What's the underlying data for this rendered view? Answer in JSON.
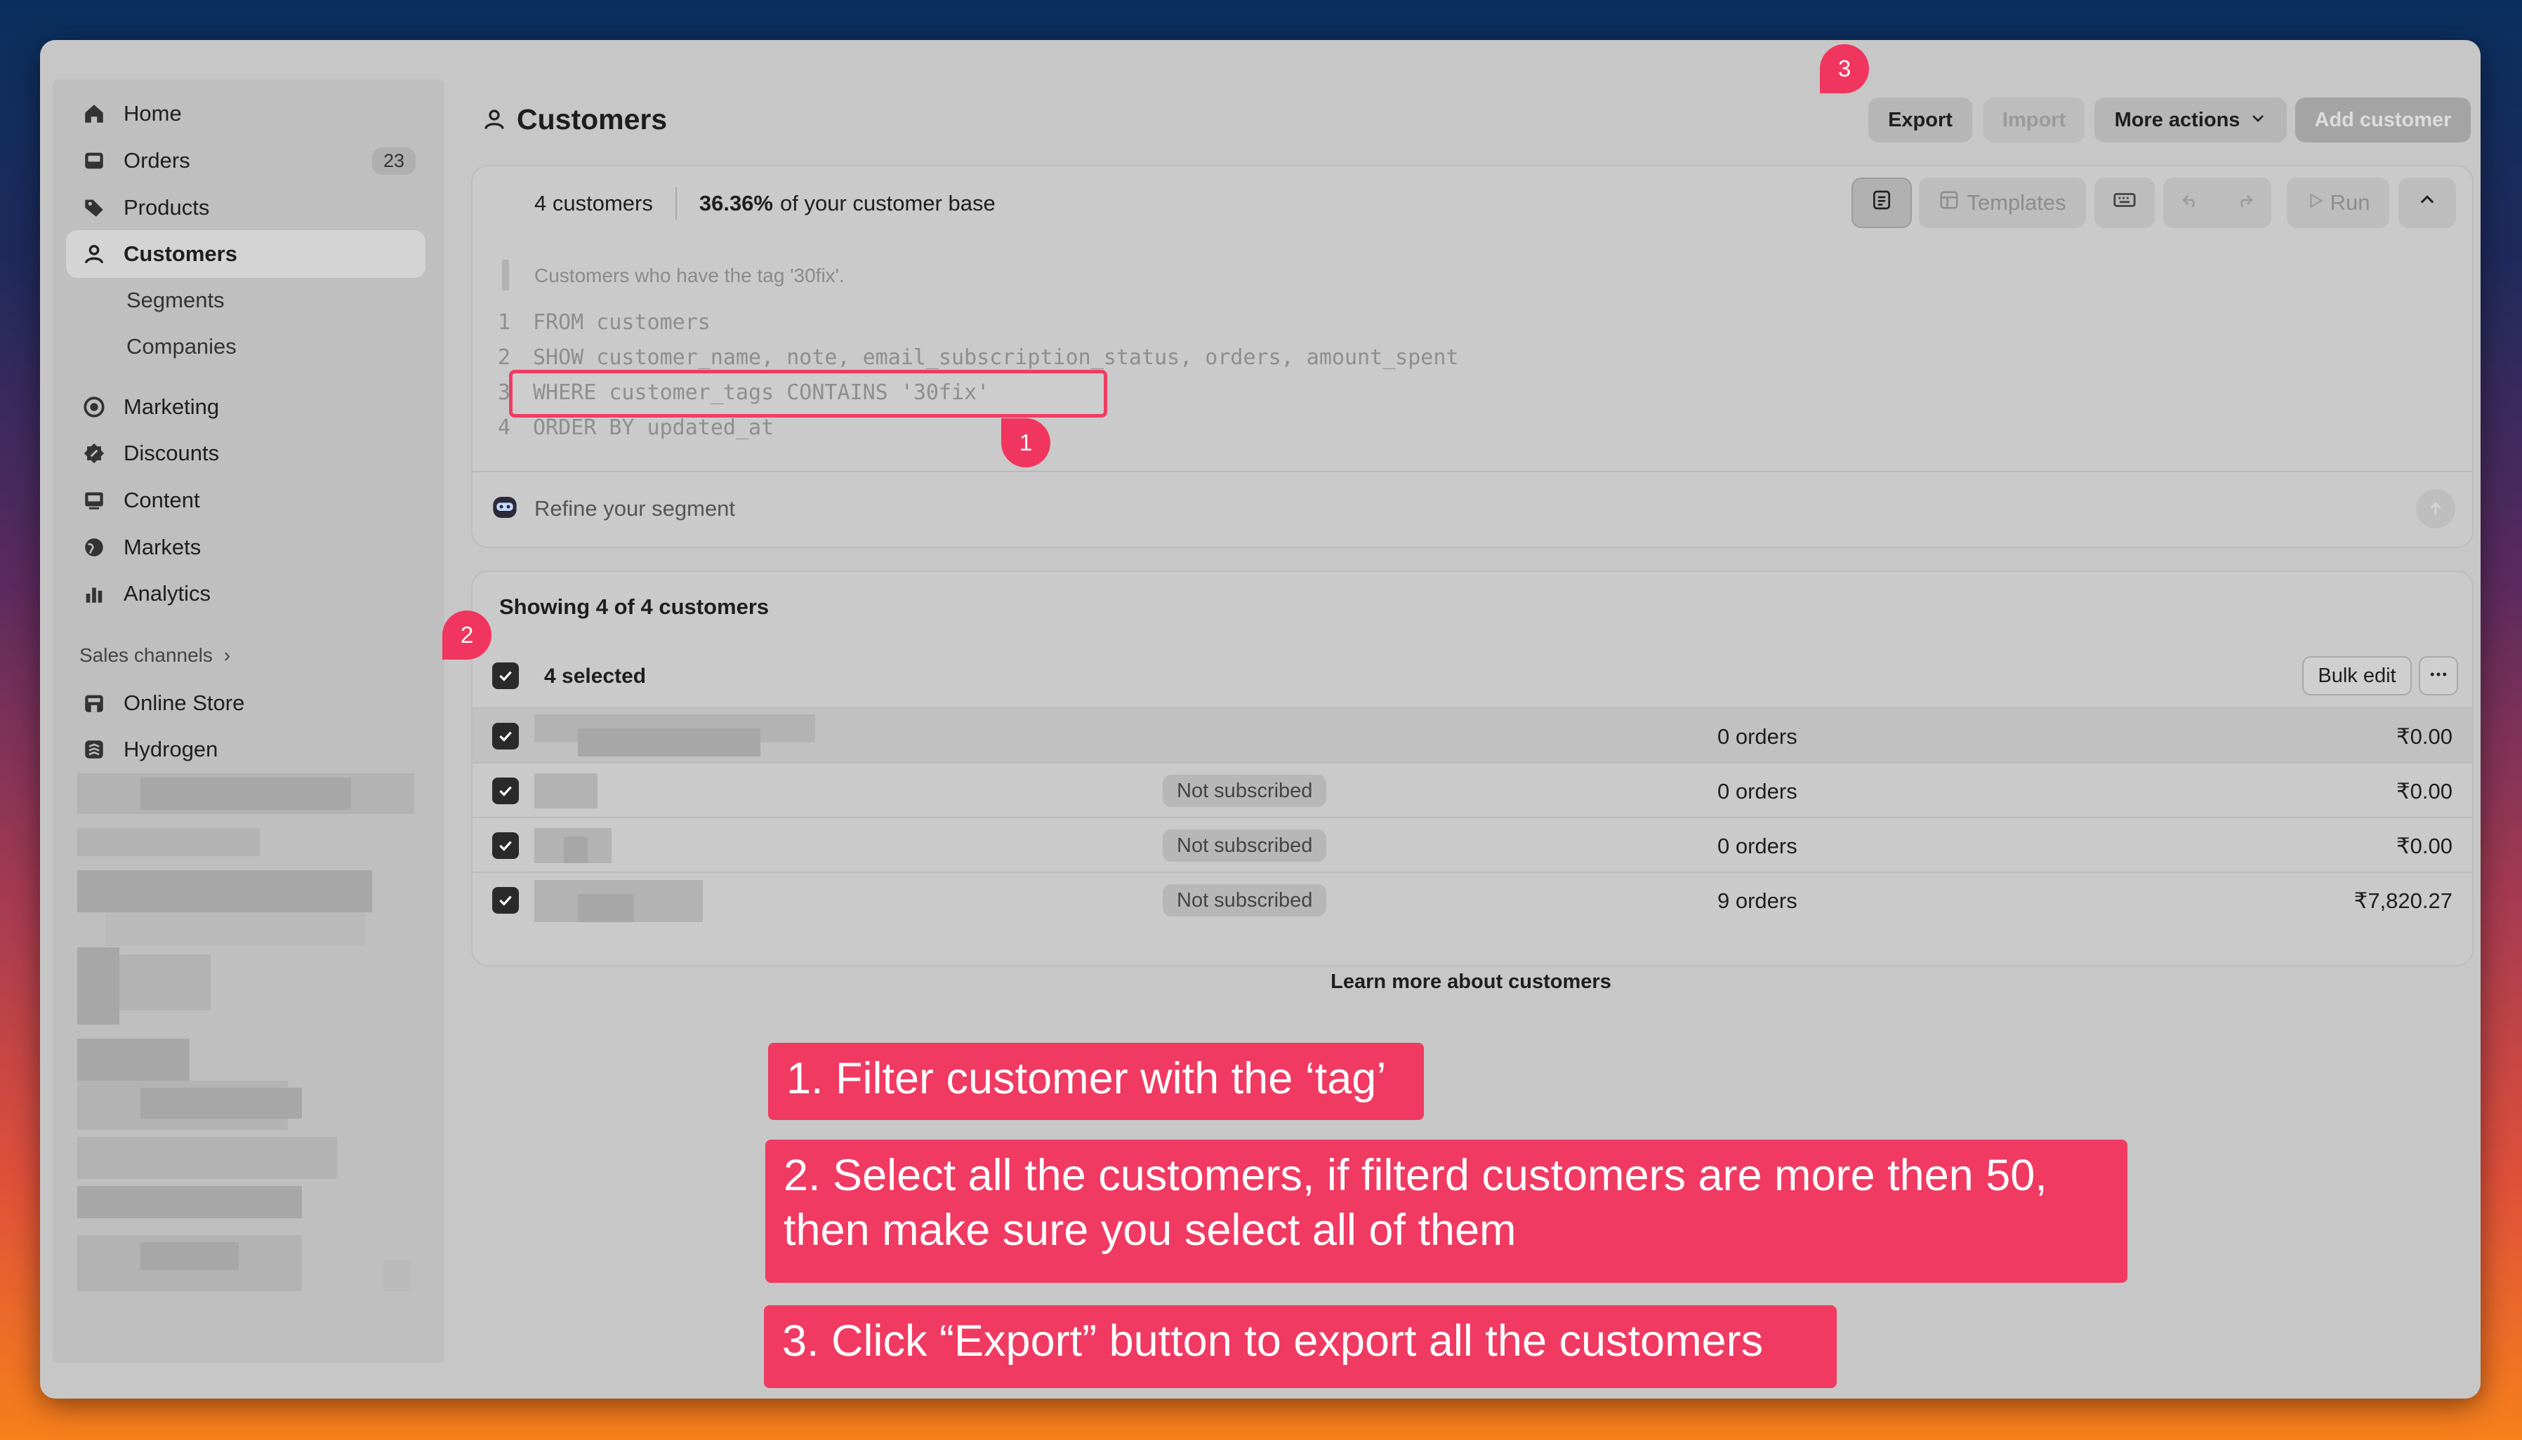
{
  "sidebar": {
    "items": [
      {
        "label": "Home",
        "icon": "home-icon"
      },
      {
        "label": "Orders",
        "icon": "inbox-icon",
        "count": "23"
      },
      {
        "label": "Products",
        "icon": "tag-icon"
      },
      {
        "label": "Customers",
        "icon": "person-icon",
        "active": true
      },
      {
        "label": "Segments"
      },
      {
        "label": "Companies"
      },
      {
        "label": "Marketing",
        "icon": "target-icon"
      },
      {
        "label": "Discounts",
        "icon": "discount-icon"
      },
      {
        "label": "Content",
        "icon": "image-icon"
      },
      {
        "label": "Markets",
        "icon": "globe-icon"
      },
      {
        "label": "Analytics",
        "icon": "bar-chart-icon"
      }
    ],
    "sales_channels_label": "Sales channels",
    "channels": [
      {
        "label": "Online Store",
        "icon": "store-icon"
      },
      {
        "label": "Hydrogen",
        "icon": "hydrogen-icon"
      }
    ]
  },
  "header": {
    "title": "Customers",
    "export_label": "Export",
    "import_label": "Import",
    "more_actions_label": "More actions",
    "add_customer_label": "Add customer"
  },
  "query": {
    "customer_count": "4 customers",
    "base_percent": "36.36%",
    "base_suffix": "of your customer base",
    "templates_label": "Templates",
    "run_label": "Run",
    "description": "Customers who have the tag '30fix'.",
    "lines": [
      {
        "num": "1",
        "code": "FROM customers"
      },
      {
        "num": "2",
        "code": "SHOW customer_name, note, email_subscription_status, orders, amount_spent"
      },
      {
        "num": "3",
        "code": "WHERE customer_tags CONTAINS '30fix'"
      },
      {
        "num": "4",
        "code": "ORDER BY updated_at"
      }
    ],
    "refine_placeholder": "Refine your segment"
  },
  "table": {
    "showing": "Showing 4 of 4 customers",
    "selected": "4 selected",
    "bulk_edit_label": "Bulk edit",
    "rows": [
      {
        "subscription": "",
        "orders": "0 orders",
        "amount": "₹0.00"
      },
      {
        "subscription": "Not subscribed",
        "orders": "0 orders",
        "amount": "₹0.00"
      },
      {
        "subscription": "Not subscribed",
        "orders": "0 orders",
        "amount": "₹0.00"
      },
      {
        "subscription": "Not subscribed",
        "orders": "9 orders",
        "amount": "₹7,820.27"
      }
    ],
    "learn_more": "Learn more about customers"
  },
  "annotations": {
    "markers": [
      "1",
      "2",
      "3"
    ],
    "callouts": [
      "1. Filter customer with the ‘tag’",
      "2. Select all the customers, if filterd customers are more then 50, then make sure you select all of them",
      "3. Click “Export” button to export all the customers"
    ],
    "color": "#f03a62"
  }
}
